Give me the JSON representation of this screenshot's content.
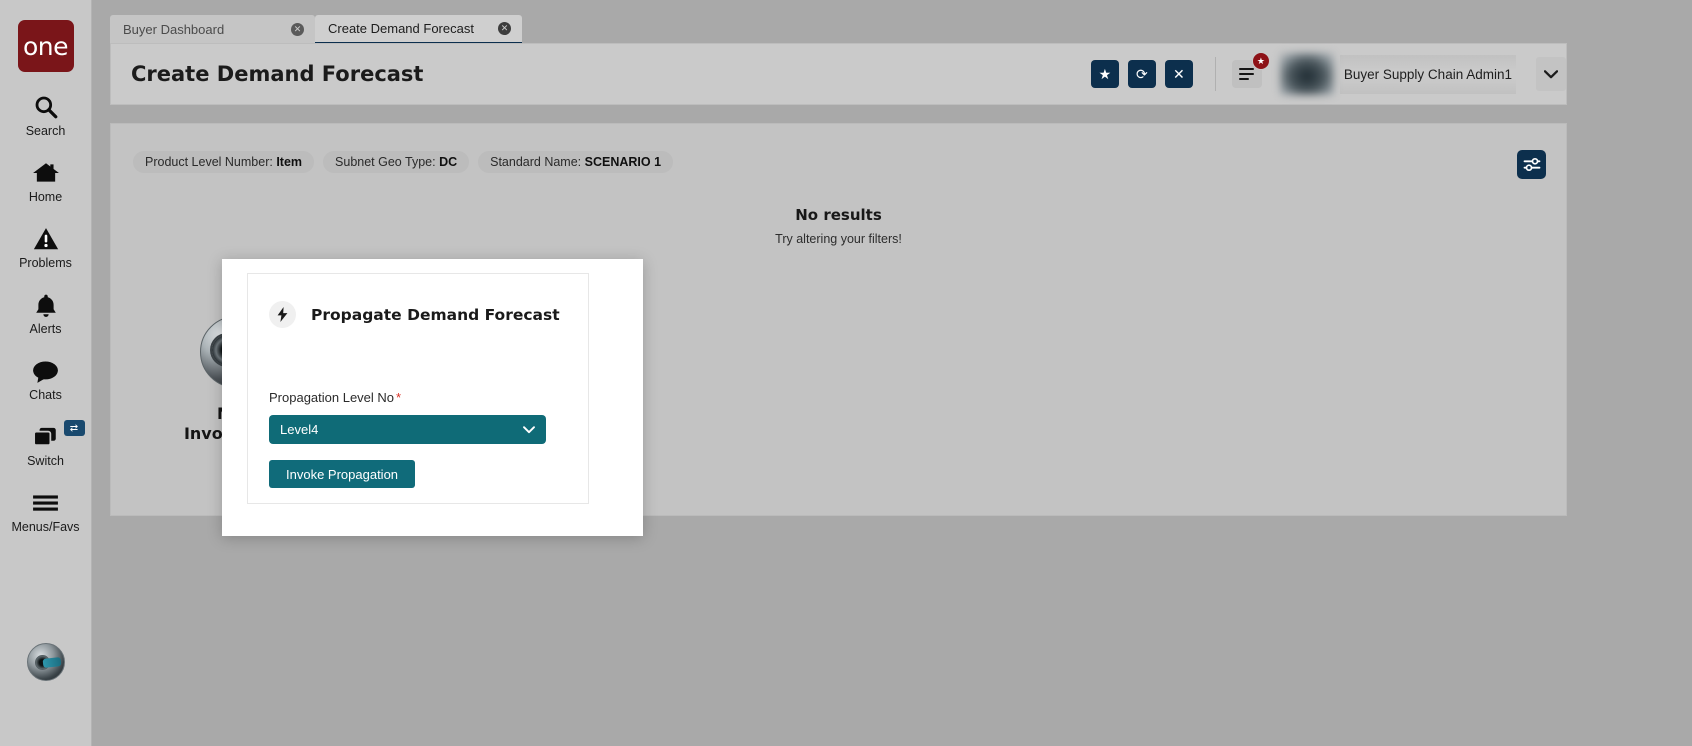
{
  "app": {
    "logo_text": "one",
    "brand_color": "#7a1519",
    "accent_navy": "#0c2f4d",
    "accent_teal": "#0f6b77"
  },
  "sidebar": {
    "items": [
      {
        "label": "Search",
        "icon": "search-icon"
      },
      {
        "label": "Home",
        "icon": "home-icon"
      },
      {
        "label": "Problems",
        "icon": "warning-triangle-icon"
      },
      {
        "label": "Alerts",
        "icon": "bell-icon"
      },
      {
        "label": "Chats",
        "icon": "chat-bubble-icon"
      },
      {
        "label": "Switch",
        "icon": "switch-windows-icon",
        "badge": "⇄"
      },
      {
        "label": "Menus/Favs",
        "icon": "hamburger-icon"
      }
    ],
    "avatar_icon": "neo-avatar-icon"
  },
  "tabs": [
    {
      "label": "Buyer Dashboard",
      "active": false,
      "close_icon": "close-circle-icon"
    },
    {
      "label": "Create Demand Forecast",
      "active": true,
      "close_icon": "close-circle-icon"
    }
  ],
  "header": {
    "title": "Create Demand Forecast",
    "actions": [
      {
        "name": "favorite-button",
        "icon": "star-icon",
        "glyph": "★"
      },
      {
        "name": "refresh-button",
        "icon": "refresh-icon",
        "glyph": "⟳"
      },
      {
        "name": "close-button",
        "icon": "x-icon",
        "glyph": "✕"
      }
    ],
    "menu_button": {
      "icon": "hamburger-icon",
      "badge_icon": "star-icon",
      "badge_glyph": "★"
    },
    "user": {
      "name": "Buyer Supply Chain Admin1",
      "avatar_icon": "user-avatar",
      "caret_icon": "chevron-down-icon"
    }
  },
  "content": {
    "chips": [
      {
        "label": "Product Level Number:",
        "value": "Item"
      },
      {
        "label": "Subnet Geo Type:",
        "value": "DC"
      },
      {
        "label": "Standard Name:",
        "value": "SCENARIO 1"
      }
    ],
    "settings_button": {
      "icon": "sliders-icon"
    },
    "empty_state": {
      "title": "No results",
      "subtitle": "Try altering your filters!"
    },
    "neo": {
      "line1": "NEO",
      "line2": "Invocations",
      "avatar_icon": "neo-avatar-icon",
      "badge_icon": "lightning-bolt-icon"
    }
  },
  "modal": {
    "icon": "lightning-bolt-icon",
    "title": "Propagate Demand Forecast",
    "field": {
      "label": "Propagation Level No",
      "required_marker": "*",
      "selected_value": "Level4",
      "caret_icon": "chevron-down-icon"
    },
    "submit_label": "Invoke Propagation"
  }
}
